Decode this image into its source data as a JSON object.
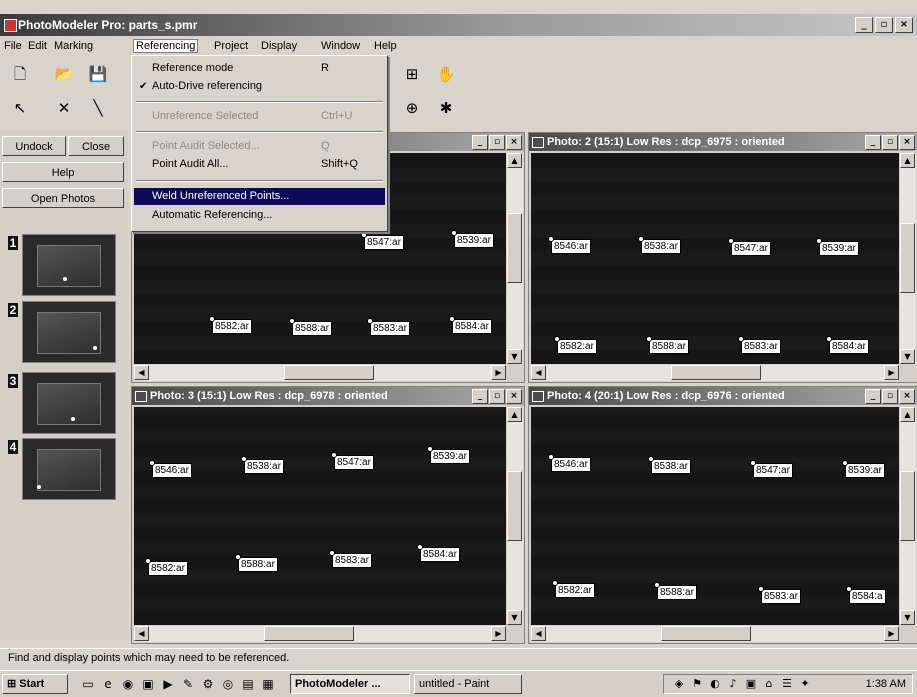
{
  "app": {
    "title": "PhotoModeler Pro: parts_s.pmr"
  },
  "menubar": {
    "items": [
      "File",
      "Edit",
      "Marking",
      "Referencing",
      "Project",
      "Display",
      "Window",
      "Help"
    ]
  },
  "dropdown": {
    "items": [
      {
        "label": "Reference mode",
        "shortcut": "R"
      },
      {
        "label": "Auto-Drive referencing",
        "shortcut": "",
        "checked": true
      },
      {
        "label": "Unreference Selected",
        "shortcut": "Ctrl+U",
        "disabled": true
      },
      {
        "label": "Point Audit Selected...",
        "shortcut": "Q",
        "disabled": true
      },
      {
        "label": "Point Audit All...",
        "shortcut": "Shift+Q"
      },
      {
        "label": "Weld Unreferenced Points...",
        "shortcut": "",
        "highlighted": true
      },
      {
        "label": "Automatic Referencing...",
        "shortcut": ""
      }
    ]
  },
  "leftpanel": {
    "undock": "Undock",
    "close": "Close",
    "help": "Help",
    "open_photos": "Open Photos",
    "thumbs": [
      "1",
      "2",
      "3",
      "4"
    ]
  },
  "windows": [
    {
      "title": "",
      "points": [
        "8547:ar",
        "8539:ar",
        "8582:ar",
        "8588:ar",
        "8583:ar",
        "8584:ar"
      ]
    },
    {
      "title": "Photo: 2 (15:1) Low Res : dcp_6975 : oriented",
      "points": [
        "8546:ar",
        "8538:ar",
        "8547:ar",
        "8539:ar",
        "8582:ar",
        "8588:ar",
        "8583:ar",
        "8584:ar"
      ]
    },
    {
      "title": "Photo: 3 (15:1) Low Res : dcp_6978 : oriented",
      "points": [
        "8546:ar",
        "8538:ar",
        "8547:ar",
        "8539:ar",
        "8582:ar",
        "8588:ar",
        "8583:ar",
        "8584:ar"
      ]
    },
    {
      "title": "Photo: 4 (20:1) Low Res : dcp_6976 : oriented",
      "points": [
        "8546:ar",
        "8538:ar",
        "8547:ar",
        "8539:ar",
        "8582:ar",
        "8588:ar",
        "8583:ar",
        "8584:a"
      ]
    }
  ],
  "status": {
    "text": "Find and display points which may need to be referenced."
  },
  "taskbar": {
    "start": "Start",
    "tasks": [
      "PhotoModeler ...",
      "untitled - Paint"
    ],
    "clock": "1:38 AM"
  },
  "icons": {
    "new": "new-document-icon",
    "open": "open-folder-icon",
    "save": "save-icon",
    "select": "arrow-select-icon",
    "delete": "delete-x-icon",
    "line": "line-tool-icon"
  }
}
